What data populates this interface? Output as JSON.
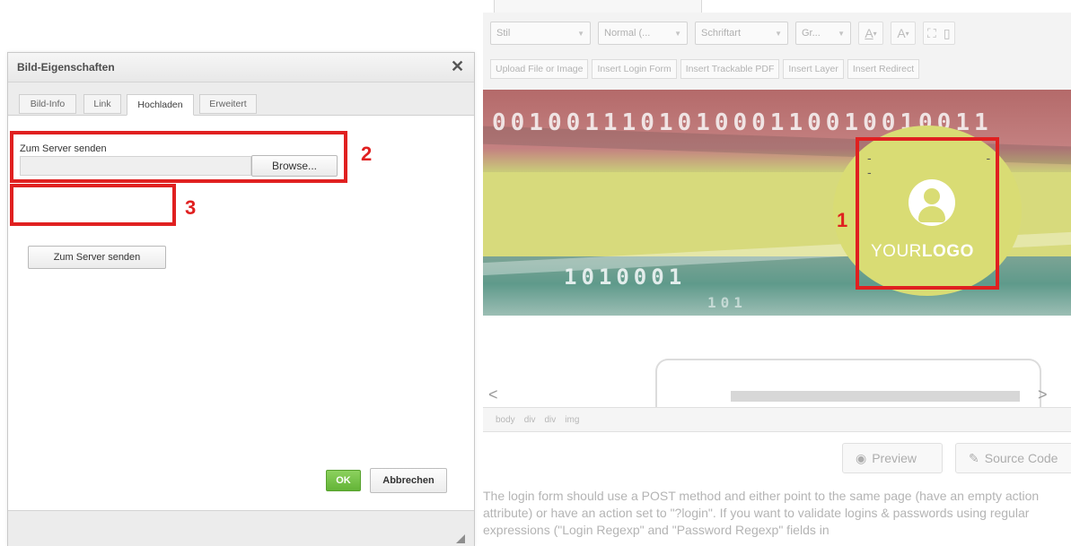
{
  "dialog": {
    "title": "Bild-Eigenschaften",
    "close_glyph": "✕",
    "tabs": [
      {
        "label": "Bild-Info"
      },
      {
        "label": "Link"
      },
      {
        "label": "Hochladen"
      },
      {
        "label": "Erweitert"
      }
    ],
    "active_tab": "Hochladen",
    "upload_label": "Zum Server senden",
    "browse_label": "Browse...",
    "send_button_label": "Zum Server senden",
    "ok_label": "OK",
    "cancel_label": "Abbrechen"
  },
  "annotations": {
    "n1": "1",
    "n2": "2",
    "n3": "3",
    "color": "#e02020"
  },
  "editor": {
    "toolbar": {
      "style_combo": "Stil",
      "format_combo": "Normal (...",
      "font_combo": "Schriftart",
      "size_combo": "Gr...",
      "text_color_glyph": "A",
      "bg_color_glyph": "A",
      "maximize_glyph": "⛶",
      "blocks_glyph": "▯",
      "plugins": [
        "Upload File or Image",
        "Insert Login Form",
        "Insert Trackable PDF",
        "Insert Layer",
        "Insert Redirect"
      ]
    },
    "banner": {
      "binary_top": "001001110101000110010010011",
      "binary_mid": "1010001",
      "binary_low": "101",
      "logo_text_regular": "YOUR",
      "logo_text_bold": "LOGO",
      "dashes": "- - -"
    },
    "scroll_left": "<",
    "scroll_right": ">",
    "path": [
      "body",
      "div",
      "div",
      "img"
    ],
    "preview_label": "Preview",
    "source_label": "Source Code",
    "help_text": "The login form should use a POST method and either point to the same page (have an empty action attribute) or have an action set to \"?login\". If you want to validate logins & passwords using regular expressions (\"Login Regexp\" and \"Password Regexp\" fields in"
  }
}
